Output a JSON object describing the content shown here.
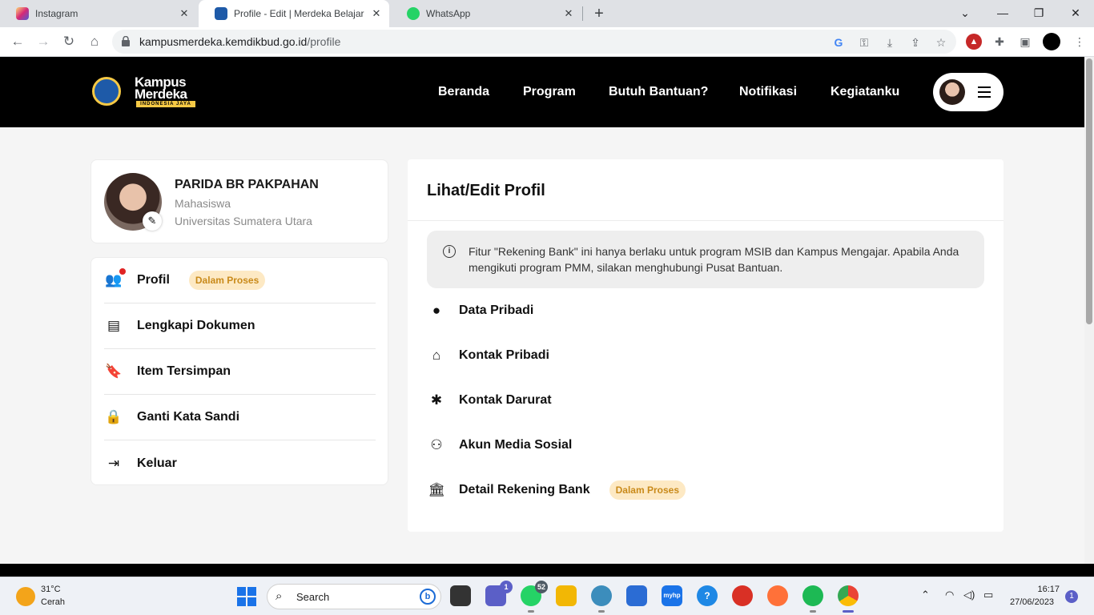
{
  "browser": {
    "tabs": [
      {
        "title": "Instagram",
        "active": false,
        "favicon_color": "#d6249f"
      },
      {
        "title": "Profile - Edit | Merdeka Belajar - K",
        "active": true,
        "favicon_color": "#1e5aa8"
      },
      {
        "title": "WhatsApp",
        "active": false,
        "favicon_color": "#25d366"
      }
    ],
    "close_glyph": "✕",
    "new_tab_glyph": "+",
    "window_controls": {
      "minimize": "—",
      "restore": "❐",
      "close": "✕",
      "tab_search": "⌄"
    },
    "nav": {
      "back": "←",
      "forward": "→",
      "reload": "↻",
      "home": "⌂"
    },
    "url_host": "kampusmerdeka.kemdikbud.go.id",
    "url_path": "/profile",
    "omnibox_icons": [
      "google-icon",
      "key-icon",
      "install-icon",
      "share-icon",
      "bookmark-star-icon"
    ],
    "extension_icons": [
      "extension-red-icon",
      "puzzle-icon",
      "sidepanel-icon",
      "profile-avatar-icon"
    ]
  },
  "site": {
    "logo": {
      "line1": "Kampus",
      "line2": "Merdeka",
      "tagline": "INDONESIA JAYA"
    },
    "nav": [
      "Beranda",
      "Program",
      "Butuh Bantuan?",
      "Notifikasi",
      "Kegiatanku"
    ],
    "accent": "#f6c945"
  },
  "user": {
    "name": "PARIDA BR PAKPAHAN",
    "role": "Mahasiswa",
    "university": "Universitas Sumatera Utara"
  },
  "sidebar": {
    "items": [
      {
        "label": "Profil",
        "icon": "user-cog-icon",
        "badge": "Dalam Proses",
        "glyph": "👥"
      },
      {
        "label": "Lengkapi Dokumen",
        "icon": "document-icon",
        "badge": "",
        "glyph": "▤"
      },
      {
        "label": "Item Tersimpan",
        "icon": "bookmark-icon",
        "badge": "",
        "glyph": "🔖"
      },
      {
        "label": "Ganti Kata Sandi",
        "icon": "lock-icon",
        "badge": "",
        "glyph": "🔒"
      },
      {
        "label": "Keluar",
        "icon": "logout-icon",
        "badge": "",
        "glyph": "⇥"
      }
    ]
  },
  "main": {
    "title": "Lihat/Edit Profil",
    "info": "Fitur \"Rekening Bank\" ini hanya berlaku untuk program MSIB dan Kampus Mengajar. Apabila Anda mengikuti program PMM, silakan menghubungi Pusat Bantuan.",
    "sections": [
      {
        "label": "Data Pribadi",
        "icon": "account-circle-icon",
        "glyph": "●",
        "badge": ""
      },
      {
        "label": "Kontak Pribadi",
        "icon": "home-icon",
        "glyph": "⌂",
        "badge": ""
      },
      {
        "label": "Kontak Darurat",
        "icon": "asterisk-icon",
        "glyph": "✱",
        "badge": ""
      },
      {
        "label": "Akun Media Sosial",
        "icon": "people-icon",
        "glyph": "⚇",
        "badge": ""
      },
      {
        "label": "Detail Rekening Bank",
        "icon": "bank-icon",
        "glyph": "🏛",
        "badge": "Dalam Proses"
      }
    ]
  },
  "taskbar": {
    "weather_temp": "31°C",
    "weather_desc": "Cerah",
    "search_placeholder": "Search",
    "apps": [
      {
        "name": "file-explorer-dark",
        "color": "#333333",
        "badge": ""
      },
      {
        "name": "teams",
        "color": "#5b5fc7",
        "badge": "1"
      },
      {
        "name": "whatsapp",
        "color": "#25d366",
        "badge": "52"
      },
      {
        "name": "file-explorer",
        "color": "#f2b705",
        "badge": ""
      },
      {
        "name": "chrome-profile",
        "color": "#3c8dbc",
        "badge": ""
      },
      {
        "name": "store",
        "color": "#2b6cd4",
        "badge": ""
      },
      {
        "name": "myhp",
        "color": "#1a73e8",
        "badge": ""
      },
      {
        "name": "help",
        "color": "#1e88e5",
        "badge": ""
      },
      {
        "name": "game",
        "color": "#d93025",
        "badge": ""
      },
      {
        "name": "firefox",
        "color": "#ff7139",
        "badge": ""
      },
      {
        "name": "spotify",
        "color": "#1db954",
        "badge": ""
      },
      {
        "name": "chrome",
        "color": "#4285f4",
        "badge": ""
      }
    ],
    "time": "16:17",
    "date": "27/06/2023",
    "notification_count": "1"
  }
}
